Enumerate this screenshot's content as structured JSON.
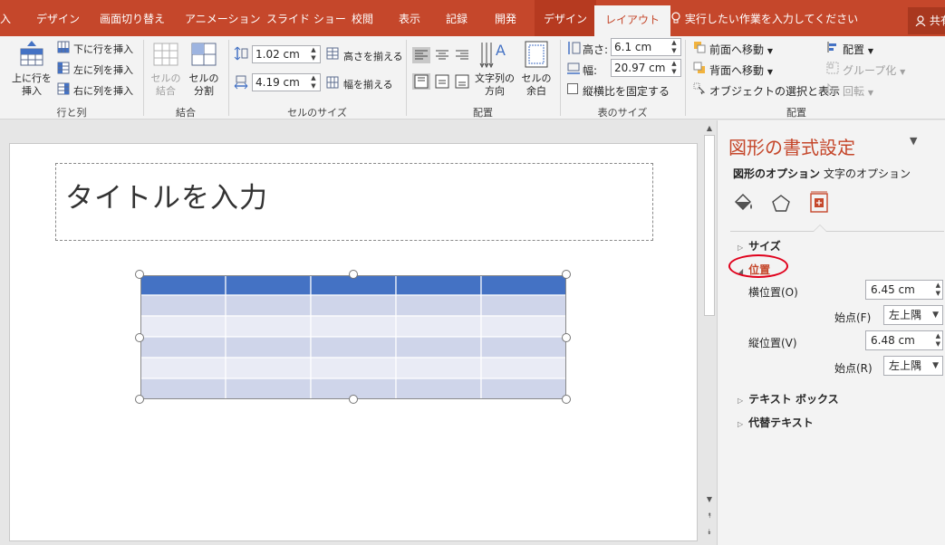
{
  "tabs": {
    "items": [
      "入",
      "デザイン",
      "画面切り替え",
      "アニメーション",
      "スライド ショー",
      "校閲",
      "表示",
      "記録",
      "開発"
    ],
    "context": "デザイン",
    "active": "レイアウト",
    "tell_me": "実行したい作業を入力してください",
    "share": "共有"
  },
  "ribbon": {
    "rows_cols": {
      "insert_above": "上に行を\n挿入",
      "insert_below": "下に行を挿入",
      "insert_left": "左に列を挿入",
      "insert_right": "右に列を挿入",
      "label": "行と列"
    },
    "merge": {
      "merge_cells": "セルの\n結合",
      "split_cells": "セルの\n分割",
      "label": "結合"
    },
    "cell_size": {
      "height_value": "1.02 cm",
      "width_value": "4.19 cm",
      "distribute_rows": "高さを揃える",
      "distribute_cols": "幅を揃える",
      "label": "セルのサイズ"
    },
    "alignment": {
      "text_direction": "文字列の\n方向",
      "cell_margins": "セルの\n余白",
      "label": "配置"
    },
    "table_size": {
      "height_label": "高さ:",
      "height_value": "6.1 cm",
      "width_label": "幅:",
      "width_value": "20.97 cm",
      "lock_aspect": "縦横比を固定する",
      "label": "表のサイズ"
    },
    "arrange": {
      "bring_forward": "前面へ移動",
      "send_backward": "背面へ移動",
      "selection_pane": "オブジェクトの選択と表示",
      "align": "配置",
      "group": "グループ化",
      "rotate": "回転",
      "label": "配置"
    }
  },
  "slide": {
    "title_placeholder": "タイトルを入力"
  },
  "table": {
    "rows": 6,
    "cols": 5
  },
  "pane": {
    "title": "図形の書式設定",
    "tab_shape": "図形のオプション",
    "tab_text": "文字のオプション",
    "section_size": "サイズ",
    "section_position": "位置",
    "h_pos_label": "横位置(O)",
    "h_pos_value": "6.45 cm",
    "from_label_1": "始点(F)",
    "from_value_1": "左上隅",
    "v_pos_label": "縦位置(V)",
    "v_pos_value": "6.48 cm",
    "from_label_2": "始点(R)",
    "from_value_2": "左上隅",
    "section_textbox": "テキスト ボックス",
    "section_alt_text": "代替テキスト"
  },
  "colors": {
    "accent": "#c5472b",
    "table_header": "#4472c4",
    "table_band_dark": "#cfd5ea",
    "table_band_light": "#e9ebf5",
    "annotation": "#e0001b"
  },
  "icons": {
    "fill_line": "paint-bucket-icon",
    "effects": "pentagon-icon",
    "size_props": "size-properties-icon"
  }
}
